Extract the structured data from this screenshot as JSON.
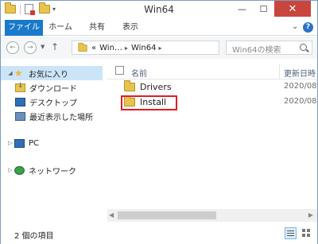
{
  "window": {
    "title": "Win64",
    "controls": {
      "minimize": "—",
      "maximize": "☐",
      "close": "✕"
    }
  },
  "ribbon": {
    "tabs": [
      {
        "label": "ファイル",
        "active": true
      },
      {
        "label": "ホーム"
      },
      {
        "label": "共有"
      },
      {
        "label": "表示"
      }
    ],
    "help": "?"
  },
  "address_bar": {
    "crumbs": [
      "«",
      "Win…",
      "Win64"
    ],
    "search_placeholder": "Win64の検索"
  },
  "nav_pane": {
    "favorites": {
      "label": "お気に入り",
      "selected": true
    },
    "favorite_items": [
      {
        "label": "ダウンロード",
        "icon": "download-folder-icon"
      },
      {
        "label": "デスクトップ",
        "icon": "desktop-icon"
      },
      {
        "label": "最近表示した場所",
        "icon": "recent-places-icon"
      }
    ],
    "pc": {
      "label": "PC",
      "icon": "pc-icon"
    },
    "network": {
      "label": "ネットワーク",
      "icon": "network-icon"
    }
  },
  "content": {
    "columns": {
      "name": "名前",
      "date": "更新日時"
    },
    "files": [
      {
        "name": "Drivers",
        "date": "2020/08"
      },
      {
        "name": "Install",
        "date": "2020/08",
        "highlighted": true
      }
    ]
  },
  "status_bar": {
    "item_count": "2 個の項目"
  },
  "colors": {
    "accent": "#1979ca",
    "close_button": "#c9463d",
    "highlight_box": "#e11c25",
    "selection": "#cce4f7"
  }
}
